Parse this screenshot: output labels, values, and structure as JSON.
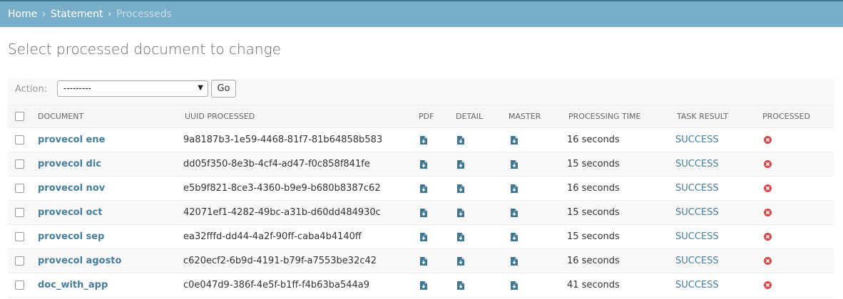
{
  "breadcrumbs": {
    "home": "Home",
    "section": "Statement",
    "current": "Processeds",
    "separator": "›"
  },
  "page_title": "Select processed document to change",
  "actions": {
    "label": "Action:",
    "selected": "---------",
    "go_label": "Go"
  },
  "table": {
    "headers": {
      "document": "Document",
      "uuid": "UUID Processed",
      "pdf": "PDF",
      "detail": "Detail",
      "master": "Master",
      "processing_time": "Processing time",
      "task_result": "Task result",
      "processed": "Processed"
    },
    "rows": [
      {
        "document": "provecol ene",
        "uuid": "9a8187b3-1e59-4468-81f7-81b64858b583",
        "time": "16 seconds",
        "result": "SUCCESS"
      },
      {
        "document": "provecol dic",
        "uuid": "dd05f350-8e3b-4cf4-ad47-f0c858f841fe",
        "time": "15 seconds",
        "result": "SUCCESS"
      },
      {
        "document": "provecol nov",
        "uuid": "e5b9f821-8ce3-4360-b9e9-b680b8387c62",
        "time": "16 seconds",
        "result": "SUCCESS"
      },
      {
        "document": "provecol oct",
        "uuid": "42071ef1-4282-49bc-a31b-d60dd484930c",
        "time": "15 seconds",
        "result": "SUCCESS"
      },
      {
        "document": "provecol sep",
        "uuid": "ea32fffd-dd44-4a2f-90ff-caba4b4140ff",
        "time": "15 seconds",
        "result": "SUCCESS"
      },
      {
        "document": "provecol agosto",
        "uuid": "c620ecf2-6b9d-4191-b79f-a7553be32c42",
        "time": "16 seconds",
        "result": "SUCCESS"
      },
      {
        "document": "doc_with_app",
        "uuid": "c0e047d9-386f-4e5f-b1ff-f4b63ba544a9",
        "time": "41 seconds",
        "result": "SUCCESS"
      }
    ]
  },
  "icons": {
    "download": "file-download-icon",
    "processed_false": "processed-no-icon"
  },
  "colors": {
    "header_bar": "#79aec8",
    "link": "#447e9b",
    "icon_blue": "#417690",
    "error_red": "#dd4646"
  }
}
